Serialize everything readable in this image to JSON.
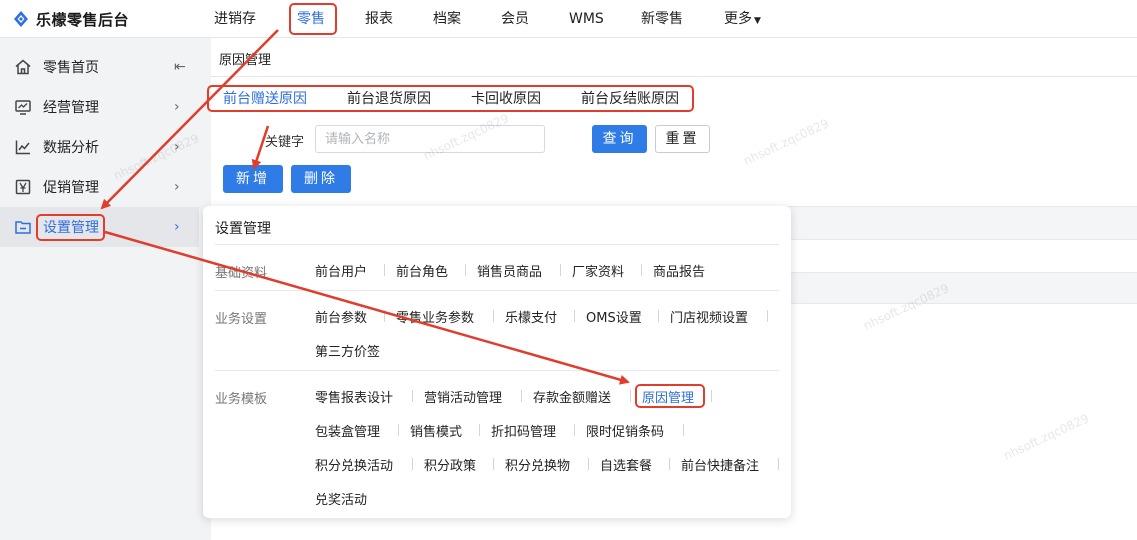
{
  "app": {
    "title": "乐檬零售后台"
  },
  "topnav": {
    "items": [
      "进销存",
      "零售",
      "报表",
      "档案",
      "会员",
      "WMS",
      "新零售",
      "更多"
    ],
    "active": "零售"
  },
  "sidebar": {
    "items": [
      {
        "label": "零售首页",
        "icon": "home-icon"
      },
      {
        "label": "经营管理",
        "icon": "monitor-chart-icon"
      },
      {
        "label": "数据分析",
        "icon": "line-chart-icon"
      },
      {
        "label": "促销管理",
        "icon": "promo-icon"
      },
      {
        "label": "设置管理",
        "icon": "folder-icon"
      }
    ],
    "collapse_glyph": "⇤",
    "arrow_glyph": "›"
  },
  "main": {
    "page_tab": "原因管理",
    "sub_tabs": [
      "前台赠送原因",
      "前台退货原因",
      "卡回收原因",
      "前台反结账原因"
    ],
    "active_sub_tab": "前台赠送原因",
    "keyword": {
      "label": "关键字",
      "placeholder": "请输入名称",
      "value": ""
    },
    "buttons": {
      "query": "查询",
      "reset": "重置",
      "add": "新增",
      "delete": "删除"
    }
  },
  "popup": {
    "title": "设置管理",
    "groups": [
      {
        "label": "基础资料",
        "items": [
          "前台用户",
          "前台角色",
          "销售员商品",
          "厂家资料",
          "商品报告"
        ]
      },
      {
        "label": "业务设置",
        "items": [
          "前台参数",
          "零售业务参数",
          "乐檬支付",
          "OMS设置",
          "门店视频设置",
          "第三方价签"
        ]
      },
      {
        "label": "业务模板",
        "items": [
          "零售报表设计",
          "营销活动管理",
          "存款金额赠送",
          "原因管理",
          "包装盒管理",
          "销售模式",
          "折扣码管理",
          "限时促销条码",
          "积分兑换活动",
          "积分政策",
          "积分兑换物",
          "自选套餐",
          "前台快捷备注",
          "兑奖活动"
        ]
      }
    ]
  },
  "watermark": "nhsoft.zqc0829",
  "colors": {
    "accent": "#2f6fe0",
    "primary_button": "#2f7ce6",
    "annotation": "#e03d2c"
  }
}
